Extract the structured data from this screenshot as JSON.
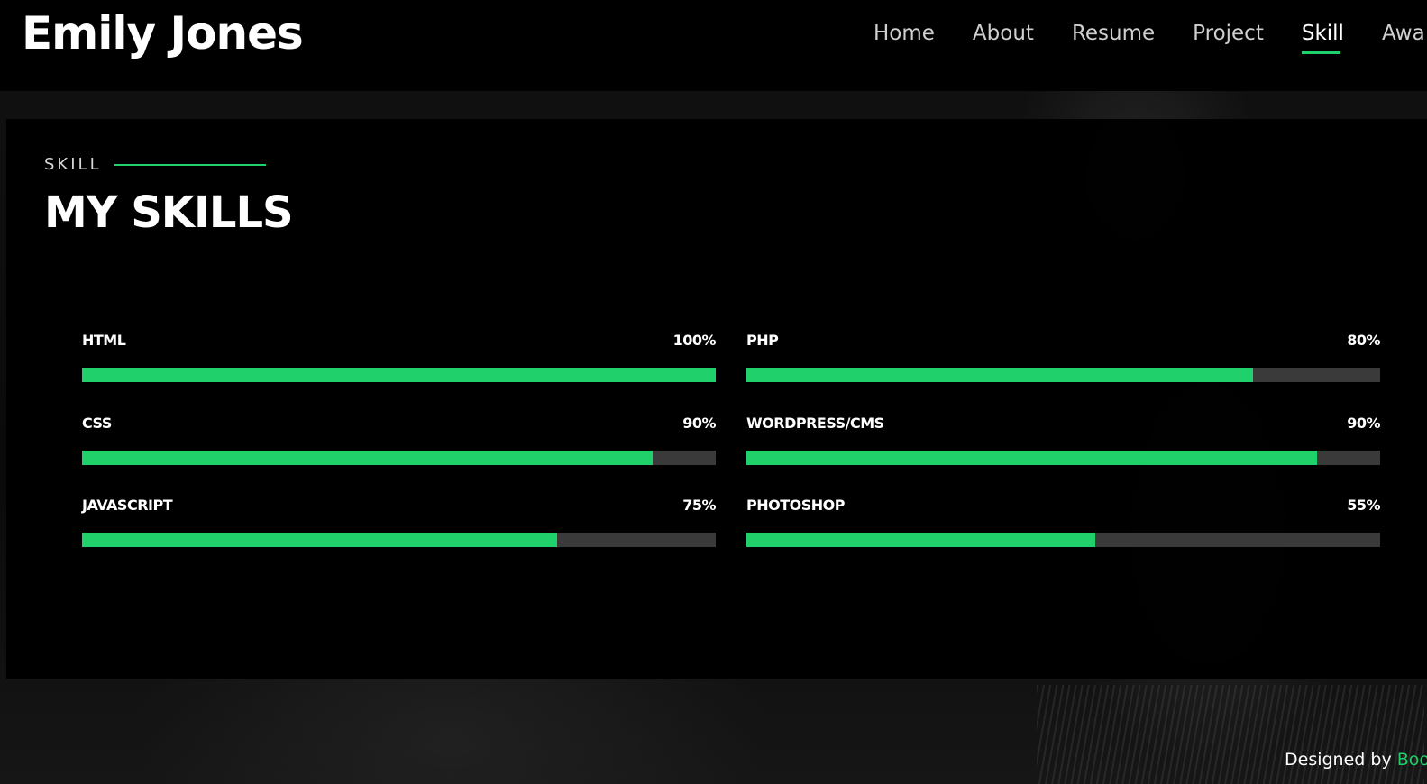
{
  "header": {
    "brand": "Emily Jones",
    "nav": [
      {
        "label": "Home",
        "active": false
      },
      {
        "label": "About",
        "active": false
      },
      {
        "label": "Resume",
        "active": false
      },
      {
        "label": "Project",
        "active": false
      },
      {
        "label": "Skill",
        "active": true
      },
      {
        "label": "Awa",
        "active": false
      }
    ]
  },
  "section": {
    "eyebrow": "SKILL",
    "title": "MY SKILLS"
  },
  "skills": [
    {
      "name": "HTML",
      "percent_label": "100%",
      "level": 1.0
    },
    {
      "name": "PHP",
      "percent_label": "80%",
      "level": 0.8
    },
    {
      "name": "CSS",
      "percent_label": "90%",
      "level": 0.9
    },
    {
      "name": "WORDPRESS/CMS",
      "percent_label": "90%",
      "level": 0.9
    },
    {
      "name": "JAVASCRIPT",
      "percent_label": "75%",
      "level": 0.75
    },
    {
      "name": "PHOTOSHOP",
      "percent_label": "55%",
      "level": 0.55
    }
  ],
  "footer": {
    "prefix": "Designed by ",
    "link": "Boo"
  },
  "colors": {
    "accent": "#20d06a",
    "track": "#3a3a3a",
    "panel": "#000000"
  }
}
